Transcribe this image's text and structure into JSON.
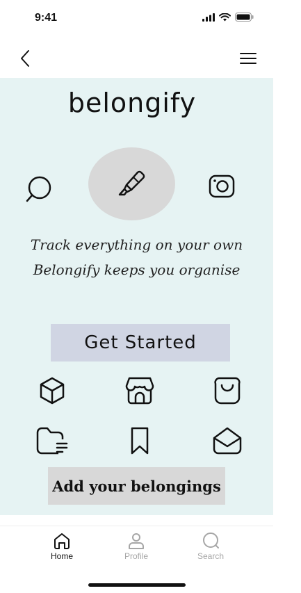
{
  "status_bar": {
    "time": "9:41"
  },
  "header": {
    "back_icon": "chevron-left-icon",
    "menu_icon": "hamburger-menu-icon"
  },
  "hero": {
    "brand": "belongify",
    "icons": [
      "search-icon",
      "highlighter-pen-icon",
      "camera-icon"
    ],
    "tagline_line1": "Track everything on your own",
    "tagline_line2": "Belongify keeps you organise"
  },
  "cta": {
    "get_started_label": "Get Started"
  },
  "categories": {
    "icons": [
      "box-icon",
      "store-icon",
      "shopping-bag-icon",
      "folder-icon",
      "bookmark-icon",
      "mail-open-icon"
    ]
  },
  "add_button": {
    "label": "Add your belongings"
  },
  "tab_bar": {
    "tabs": [
      {
        "label": "Home",
        "icon": "home-icon",
        "active": true
      },
      {
        "label": "Profile",
        "icon": "profile-icon",
        "active": false
      },
      {
        "label": "Search",
        "icon": "search-icon",
        "active": false
      }
    ]
  },
  "colors": {
    "main_bg": "#e6f3f3",
    "cta_bg": "#d0d5e3",
    "add_bg": "#d8d8d8",
    "inactive_tab": "#a6a6a6"
  }
}
